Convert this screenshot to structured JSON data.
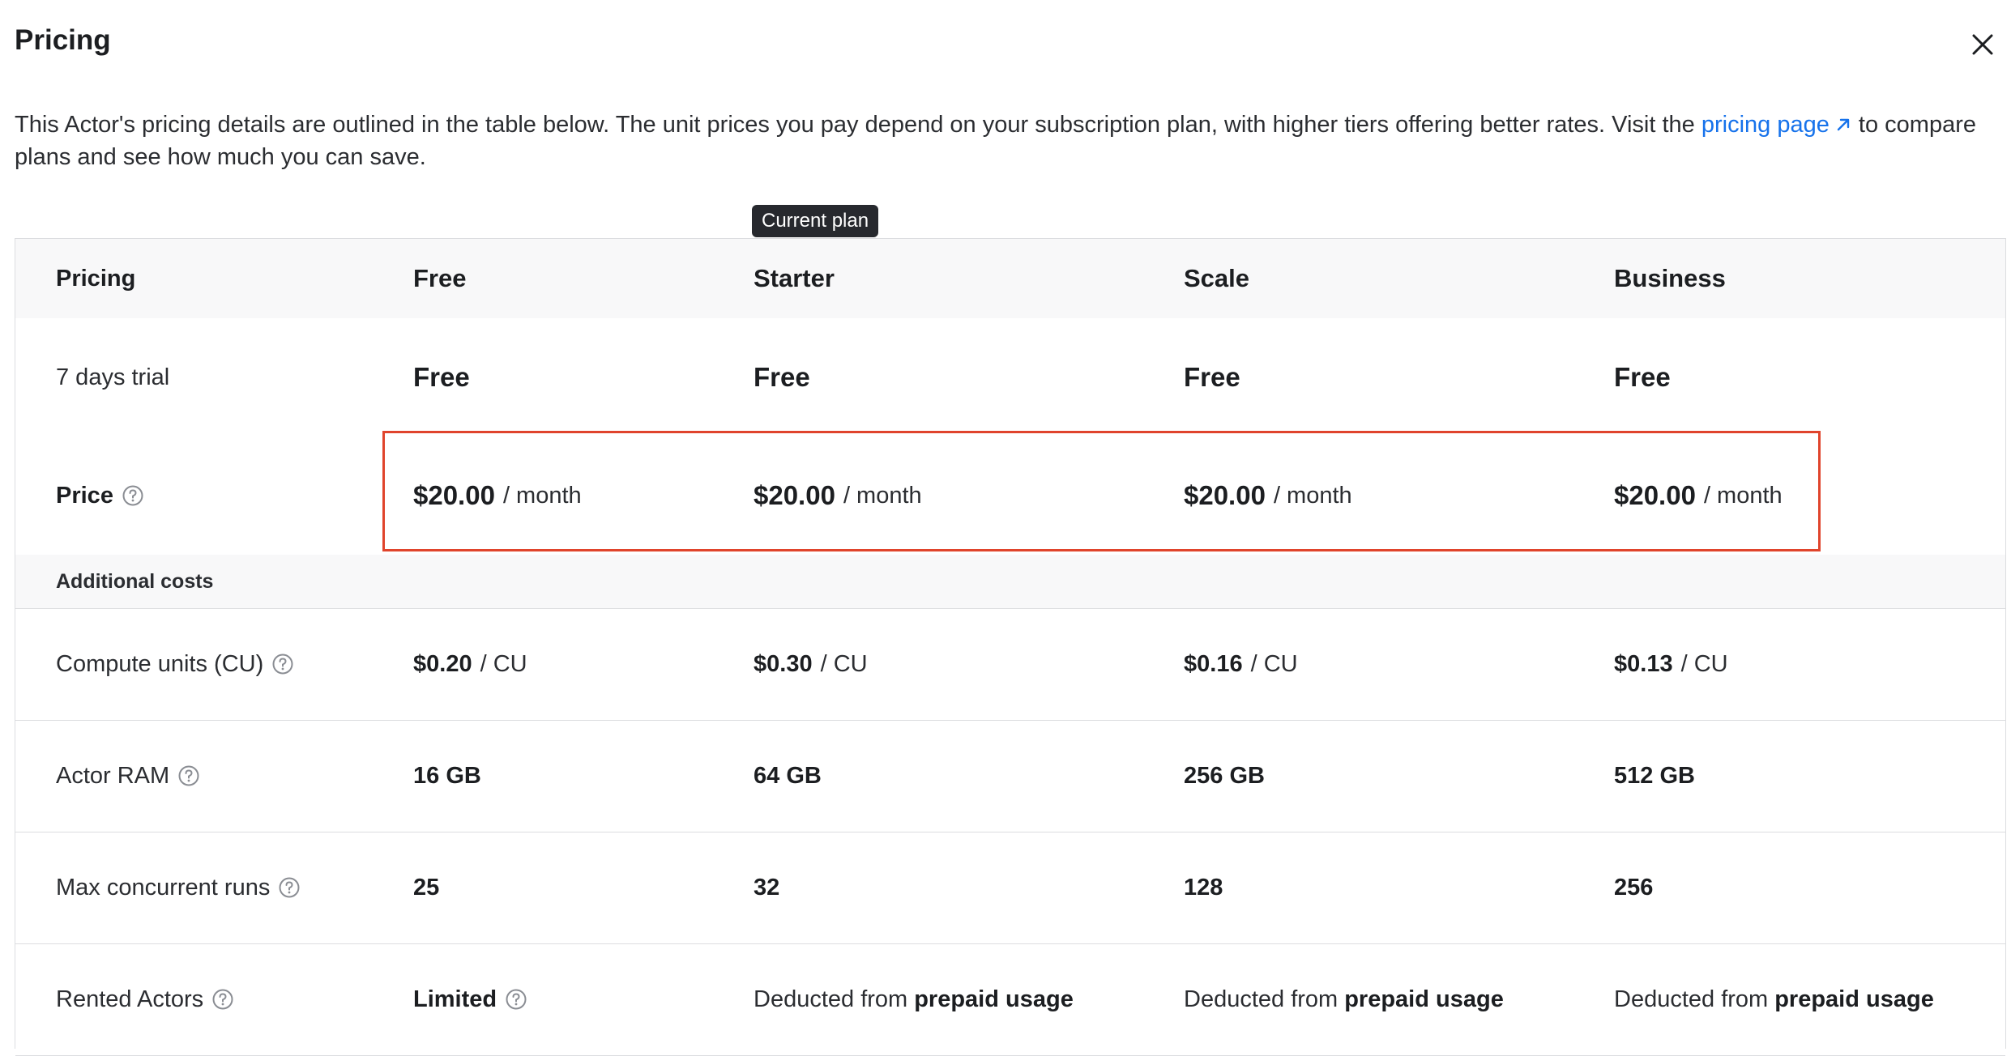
{
  "dialog": {
    "title": "Pricing",
    "intro_text": "This Actor's pricing details are outlined in the table below. The unit prices you pay depend on your subscription plan, with higher tiers offering better rates. Visit the",
    "intro_link": "pricing page",
    "intro_text_after": "to compare plans and see how much you can save.",
    "current_plan_badge": "Current plan",
    "close_icon": "close-icon",
    "help_icon": "question-circle-icon",
    "link_icon": "external-arrow-icon",
    "highlight_color": "#e0442c",
    "link_color": "#1672eb"
  },
  "table": {
    "headers": [
      "Pricing",
      "Free",
      "Starter",
      "Scale",
      "Business"
    ],
    "trial": {
      "label": "7 days trial",
      "values": [
        "Free",
        "Free",
        "Free",
        "Free"
      ]
    },
    "price": {
      "label": "Price",
      "amounts": [
        "$20.00",
        "$20.00",
        "$20.00",
        "$20.00"
      ],
      "unit": "/ month"
    },
    "additional_costs_label": "Additional costs",
    "compute_units": {
      "label": "Compute units (CU)",
      "amounts": [
        "$0.20",
        "$0.30",
        "$0.16",
        "$0.13"
      ],
      "unit": "/ CU"
    },
    "actor_ram": {
      "label": "Actor RAM",
      "values": [
        "16 GB",
        "64 GB",
        "256 GB",
        "512 GB"
      ]
    },
    "max_runs": {
      "label": "Max concurrent runs",
      "values": [
        "25",
        "32",
        "128",
        "256"
      ]
    },
    "rented_actors": {
      "label": "Rented Actors",
      "free_value": "Limited",
      "paid_prefix": "Deducted from",
      "paid_strong": "prepaid usage"
    }
  }
}
